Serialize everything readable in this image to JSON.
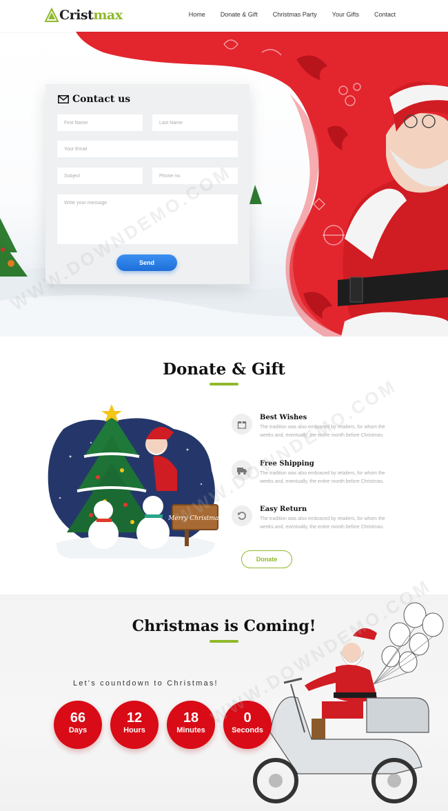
{
  "brand": {
    "name_part1": "Cristmax",
    "name_part1_split": [
      "Crist",
      "max"
    ],
    "color_dark": "#222222",
    "color_accent": "#8fb92a"
  },
  "nav": {
    "items": [
      "Home",
      "Donate & Gift",
      "Christmas Party",
      "Your Gifts",
      "Contact"
    ]
  },
  "contact": {
    "title": "Contact us",
    "first_name_placeholder": "First Name",
    "last_name_placeholder": "Last Name",
    "email_placeholder": "Your Email",
    "subject_placeholder": "Subject",
    "phone_placeholder": "Phone no.",
    "message_placeholder": "Write your message",
    "send_label": "Send",
    "send_color": "#1e6fd9"
  },
  "donate": {
    "title": "Donate & Gift",
    "features": [
      {
        "icon": "gift-icon",
        "title": "Best Wishes",
        "text": "The tradition was also embraced by retailers, for whom the weeks and, eventually, the entire month before Christmas."
      },
      {
        "icon": "truck-icon",
        "title": "Free Shipping",
        "text": "The tradition was also embraced by retailers, for whom the weeks and, eventually, the entire month before Christmas."
      },
      {
        "icon": "return-icon",
        "title": "Easy Return",
        "text": "The tradition was also embraced by retailers, for whom the weeks and, eventually, the entire month before Christmas."
      }
    ],
    "button_label": "Donate",
    "sign_text": "Merry Christmas"
  },
  "countdown": {
    "title": "Christmas is Coming!",
    "subtitle": "Let's countdown to Christmas!",
    "units": [
      {
        "value": "66",
        "label": "Days"
      },
      {
        "value": "12",
        "label": "Hours"
      },
      {
        "value": "18",
        "label": "Minutes"
      },
      {
        "value": "0",
        "label": "Seconds"
      }
    ],
    "circle_color": "#d80b16"
  },
  "watermark": "WWW.DOWNDEMO.COM"
}
